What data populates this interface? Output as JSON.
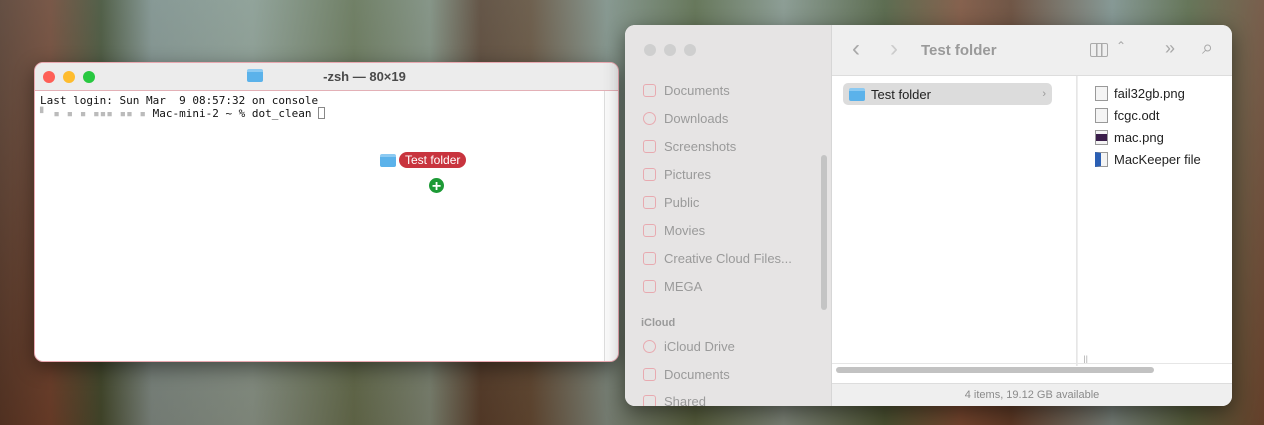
{
  "terminal": {
    "title": "-zsh — 80×19",
    "lines": [
      "Last login: Sun Mar  9 08:57:32 on console"
    ],
    "prompt": "Mac-mini-2 ~ % dot_clean "
  },
  "drag": {
    "label": "Test folder",
    "badge": "+"
  },
  "finder": {
    "title": "Test folder",
    "sidebar": [
      {
        "label": "Documents"
      },
      {
        "label": "Downloads"
      },
      {
        "label": "Screenshots"
      },
      {
        "label": "Pictures"
      },
      {
        "label": "Public"
      },
      {
        "label": "Movies"
      },
      {
        "label": "Creative Cloud Files..."
      },
      {
        "label": "MEGA"
      }
    ],
    "icloud_header": "iCloud",
    "icloud": [
      {
        "label": "iCloud Drive"
      },
      {
        "label": "Documents"
      },
      {
        "label": "Shared"
      }
    ],
    "column1": [
      {
        "label": "Test folder"
      }
    ],
    "column2": [
      {
        "label": "fail32gb.png"
      },
      {
        "label": "fcgc.odt"
      },
      {
        "label": "mac.png"
      },
      {
        "label": "MacKeeper file"
      }
    ],
    "status": "4 items, 19.12 GB available",
    "icons": {
      "back": "‹",
      "forward": "›",
      "more": "»",
      "search": "⌕",
      "view": "columns"
    }
  }
}
